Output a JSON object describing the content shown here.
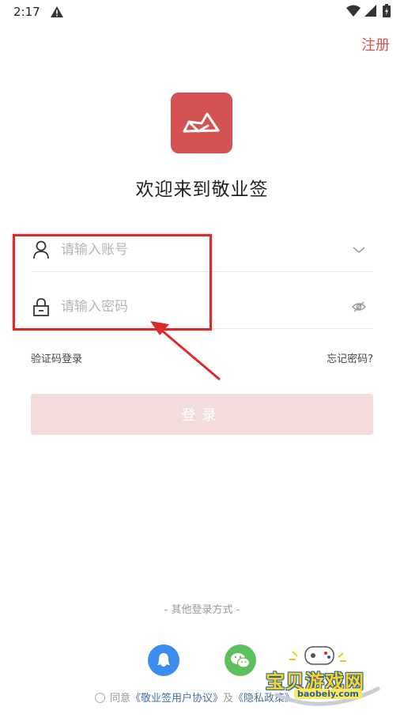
{
  "status_bar": {
    "time": "2:17",
    "icons": [
      "warning-icon",
      "wifi-icon",
      "signal-icon",
      "battery-icon"
    ]
  },
  "header": {
    "register_label": "注册"
  },
  "logo": {
    "icon": "paper-hat-logo",
    "color": "#d45352"
  },
  "welcome": {
    "title": "欢迎来到敬业签"
  },
  "form": {
    "account": {
      "placeholder": "请输入账号",
      "value": "",
      "icon": "user-icon",
      "trailing_icon": "chevron-down-icon"
    },
    "password": {
      "placeholder": "请输入密码",
      "value": "",
      "icon": "lock-icon",
      "trailing_icon": "eye-off-icon"
    }
  },
  "links": {
    "sms_login": "验证码登录",
    "forgot_password": "忘记密码?"
  },
  "login_button": {
    "label": "登录",
    "color": "#f5dcdc"
  },
  "other_login": {
    "label": "- 其他登录方式 -",
    "methods": [
      {
        "icon": "qq-icon",
        "color": "#3b8cf0"
      },
      {
        "icon": "wechat-icon",
        "color": "#5cc05f"
      }
    ]
  },
  "agreement": {
    "prefix": "同意",
    "user_agreement": "《敬业签用户协议》",
    "conjunction": "及",
    "privacy_policy": "《隐私政策》"
  },
  "watermark": {
    "text": "宝贝游戏网",
    "url": "baobeiy.com"
  },
  "annotation": {
    "color": "#d92b2b"
  }
}
